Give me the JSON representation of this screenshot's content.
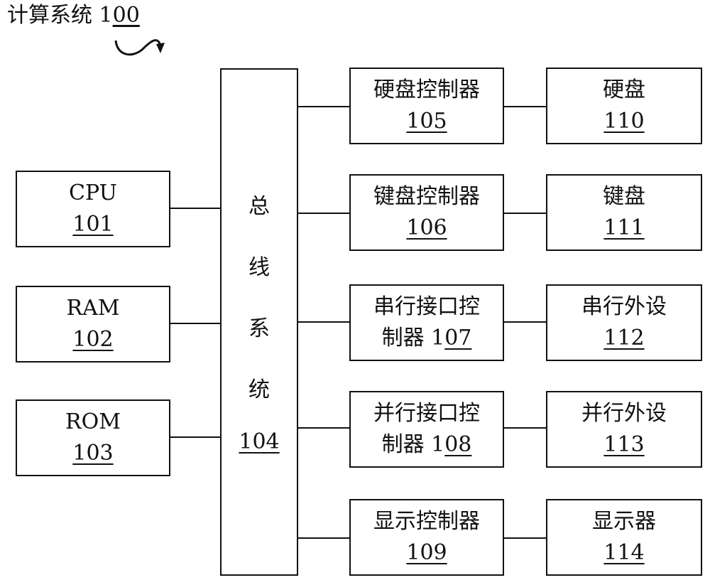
{
  "title": {
    "text": "计算系统 1",
    "ref_underlined": "00"
  },
  "bus": {
    "chars": [
      "总",
      "线",
      "系",
      "统"
    ],
    "ref": "104"
  },
  "left_components": [
    {
      "label": "CPU",
      "ref": "101"
    },
    {
      "label": "RAM",
      "ref": "102"
    },
    {
      "label": "ROM",
      "ref": "103"
    }
  ],
  "controllers": [
    {
      "line1": "硬盘控制器",
      "ref": "105"
    },
    {
      "line1": "键盘控制器",
      "ref": "106"
    },
    {
      "line1": "串行接口控",
      "line2": "制器 1",
      "ref": "07"
    },
    {
      "line1": "并行接口控",
      "line2": "制器 1",
      "ref": "08"
    },
    {
      "line1": "显示控制器",
      "ref": "109"
    }
  ],
  "peripherals": [
    {
      "label": "硬盘",
      "ref": "110"
    },
    {
      "label": "键盘",
      "ref": "111"
    },
    {
      "label": "串行外设",
      "ref": "112"
    },
    {
      "label": "并行外设",
      "ref": "113"
    },
    {
      "label": "显示器",
      "ref": "114"
    }
  ]
}
